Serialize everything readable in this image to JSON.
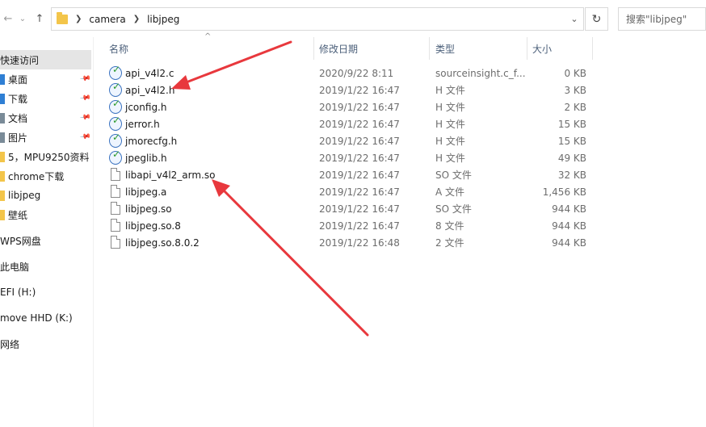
{
  "address": {
    "crumbs": [
      "camera",
      "libjpeg"
    ],
    "search_placeholder": "搜索\"libjpeg\""
  },
  "icons": {
    "back": "arrow-left-icon",
    "forward": "arrow-right-icon",
    "recent": "chevron-down-icon",
    "up": "arrow-up-icon",
    "refresh": "refresh-icon"
  },
  "sidebar": {
    "items": [
      {
        "label": "快速访问",
        "pinned": false
      },
      {
        "label": "桌面",
        "pinned": true
      },
      {
        "label": "下载",
        "pinned": true
      },
      {
        "label": "文档",
        "pinned": true
      },
      {
        "label": "图片",
        "pinned": true
      },
      {
        "label": "5，MPU9250资料",
        "pinned": false
      },
      {
        "label": "chrome下载",
        "pinned": false
      },
      {
        "label": "libjpeg",
        "pinned": false
      },
      {
        "label": "壁纸",
        "pinned": false
      },
      {
        "label": "WPS网盘",
        "pinned": false
      },
      {
        "label": "此电脑",
        "pinned": false
      },
      {
        "label": "EFI (H:)",
        "pinned": false
      },
      {
        "label": "move HHD (K:)",
        "pinned": false
      },
      {
        "label": "网络",
        "pinned": false
      }
    ]
  },
  "columns": {
    "name": "名称",
    "date": "修改日期",
    "type": "类型",
    "size": "大小"
  },
  "files": [
    {
      "name": "api_v4l2.c",
      "date": "2020/9/22 8:11",
      "type": "sourceinsight.c_f...",
      "size": "0 KB",
      "icon": "source-insight-icon"
    },
    {
      "name": "api_v4l2.h",
      "date": "2019/1/22 16:47",
      "type": "H 文件",
      "size": "3 KB",
      "icon": "source-insight-icon"
    },
    {
      "name": "jconfig.h",
      "date": "2019/1/22 16:47",
      "type": "H 文件",
      "size": "2 KB",
      "icon": "source-insight-icon"
    },
    {
      "name": "jerror.h",
      "date": "2019/1/22 16:47",
      "type": "H 文件",
      "size": "15 KB",
      "icon": "source-insight-icon"
    },
    {
      "name": "jmorecfg.h",
      "date": "2019/1/22 16:47",
      "type": "H 文件",
      "size": "15 KB",
      "icon": "source-insight-icon"
    },
    {
      "name": "jpeglib.h",
      "date": "2019/1/22 16:47",
      "type": "H 文件",
      "size": "49 KB",
      "icon": "source-insight-icon"
    },
    {
      "name": "libapi_v4l2_arm.so",
      "date": "2019/1/22 16:47",
      "type": "SO 文件",
      "size": "32 KB",
      "icon": "blank-file-icon"
    },
    {
      "name": "libjpeg.a",
      "date": "2019/1/22 16:47",
      "type": "A 文件",
      "size": "1,456 KB",
      "icon": "blank-file-icon"
    },
    {
      "name": "libjpeg.so",
      "date": "2019/1/22 16:47",
      "type": "SO 文件",
      "size": "944 KB",
      "icon": "blank-file-icon"
    },
    {
      "name": "libjpeg.so.8",
      "date": "2019/1/22 16:47",
      "type": "8 文件",
      "size": "944 KB",
      "icon": "blank-file-icon"
    },
    {
      "name": "libjpeg.so.8.0.2",
      "date": "2019/1/22 16:48",
      "type": "2 文件",
      "size": "944 KB",
      "icon": "blank-file-icon"
    }
  ],
  "annotation_color": "#e8383d"
}
